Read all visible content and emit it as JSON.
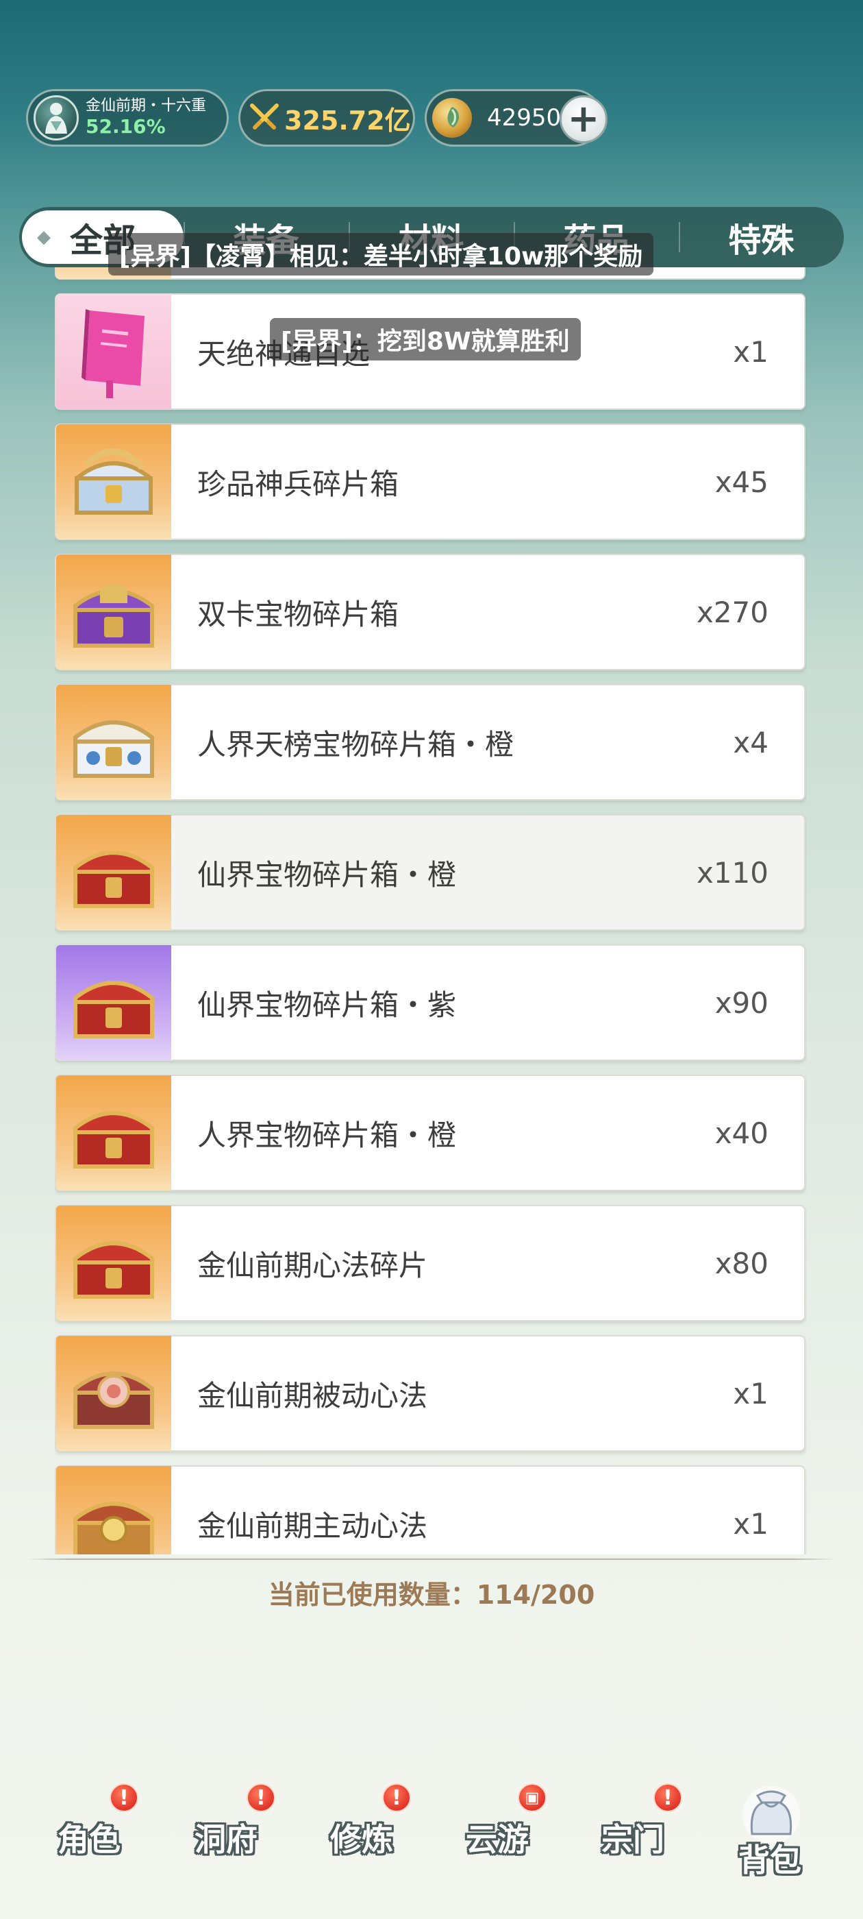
{
  "header": {
    "realm_name": "金仙前期・十六重",
    "realm_progress": "52.16%",
    "combat_power": "325.72亿",
    "currency_amount": "42950",
    "add_label": "+"
  },
  "tabs": [
    {
      "label": "全部",
      "active": true
    },
    {
      "label": "装备"
    },
    {
      "label": "材料"
    },
    {
      "label": "药品"
    },
    {
      "label": "特殊"
    }
  ],
  "items": [
    {
      "name": "天绝神通自选",
      "qty": "x1"
    },
    {
      "name": "珍品神兵碎片箱",
      "qty": "x45"
    },
    {
      "name": "双卡宝物碎片箱",
      "qty": "x270"
    },
    {
      "name": "人界天榜宝物碎片箱・橙",
      "qty": "x4"
    },
    {
      "name": "仙界宝物碎片箱・橙",
      "qty": "x110"
    },
    {
      "name": "仙界宝物碎片箱・紫",
      "qty": "x90"
    },
    {
      "name": "人界宝物碎片箱・橙",
      "qty": "x40"
    },
    {
      "name": "金仙前期心法碎片",
      "qty": "x80"
    },
    {
      "name": "金仙前期被动心法",
      "qty": "x1"
    },
    {
      "name": "金仙前期主动心法",
      "qty": "x1"
    }
  ],
  "chat": {
    "msg1": "[异界]【凌霄】相见：差半小时拿10w那个奖励",
    "msg2": "[异界]：挖到8W就算胜利"
  },
  "usage": "当前已使用数量：114/200",
  "nav": [
    {
      "label": "角色",
      "badge": "!"
    },
    {
      "label": "洞府",
      "badge": "!"
    },
    {
      "label": "修炼",
      "badge": "!"
    },
    {
      "label": "云游",
      "badge": "▣"
    },
    {
      "label": "宗门",
      "badge": "!"
    },
    {
      "label": "背包"
    }
  ]
}
